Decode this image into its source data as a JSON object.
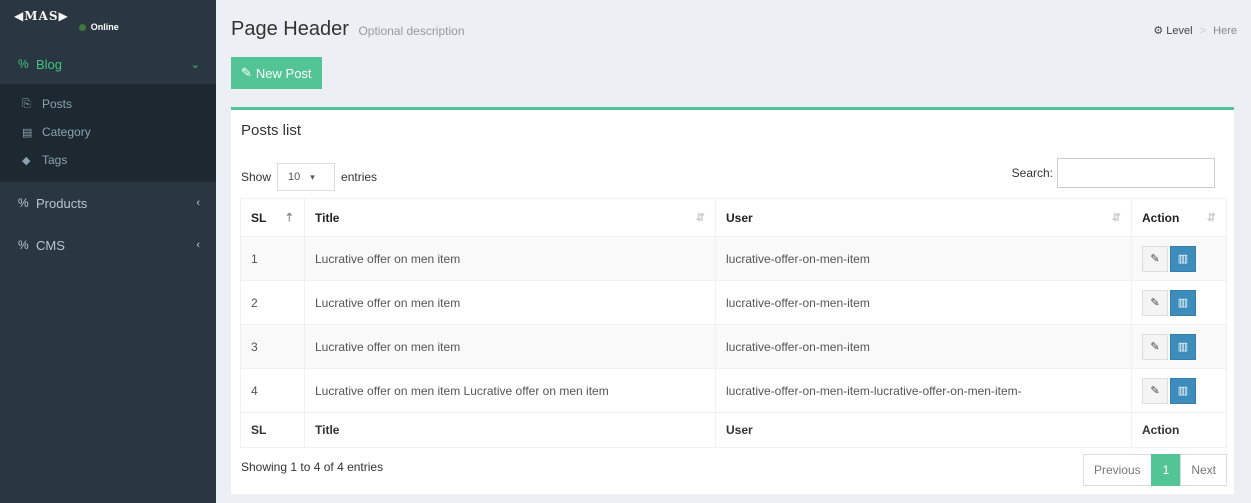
{
  "brand": {
    "logo": "◀MAS▶",
    "status": "Online"
  },
  "sidebar": {
    "blog": {
      "label": "Blog",
      "icon": "%",
      "chevron": "⌄"
    },
    "sub": [
      {
        "label": "Posts",
        "icon": "⎘"
      },
      {
        "label": "Category",
        "icon": "▤"
      },
      {
        "label": "Tags",
        "icon": "◆"
      }
    ],
    "products": {
      "label": "Products",
      "icon": "%",
      "chevron": "‹"
    },
    "cms": {
      "label": "CMS",
      "icon": "%",
      "chevron": "‹"
    }
  },
  "header": {
    "title": "Page Header",
    "description": "Optional description"
  },
  "breadcrumb": {
    "level": "Level",
    "sep": ">",
    "here": "Here"
  },
  "toolbar": {
    "new_post": "New Post",
    "pencil": "✎"
  },
  "box": {
    "title": "Posts list"
  },
  "length": {
    "show": "Show",
    "value": "10",
    "caret": "▾",
    "entries": "entries"
  },
  "search": {
    "label": "Search:"
  },
  "columns": {
    "sl": "SL",
    "title": "Title",
    "user": "User",
    "action": "Action"
  },
  "rows": [
    {
      "sl": "1",
      "title": "Lucrative offer on men item",
      "user": "lucrative-offer-on-men-item"
    },
    {
      "sl": "2",
      "title": "Lucrative offer on men item",
      "user": "lucrative-offer-on-men-item"
    },
    {
      "sl": "3",
      "title": "Lucrative offer on men item",
      "user": "lucrative-offer-on-men-item"
    },
    {
      "sl": "4",
      "title": "Lucrative offer on men item Lucrative offer on men item",
      "user": "lucrative-offer-on-men-item-lucrative-offer-on-men-item-"
    }
  ],
  "icons": {
    "edit": "✎",
    "delete": "▥",
    "sort": "⇵",
    "sort_asc": "⇡"
  },
  "footer": {
    "info": "Showing 1 to 4 of 4 entries",
    "prev": "Previous",
    "page": "1",
    "next": "Next"
  },
  "colors": {
    "accent": "#52c495",
    "primary": "#3c8dbc",
    "sidebar": "#2b3643"
  }
}
